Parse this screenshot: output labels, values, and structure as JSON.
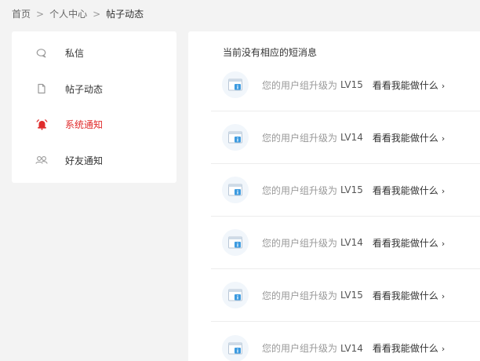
{
  "breadcrumb": {
    "home": "首页",
    "separator": ">",
    "personal_center": "个人中心",
    "current": "帖子动态"
  },
  "sidebar": {
    "items": [
      {
        "label": "私信",
        "icon": "chat-bubble-icon"
      },
      {
        "label": "帖子动态",
        "icon": "document-icon"
      },
      {
        "label": "系统通知",
        "icon": "alarm-bell-icon",
        "active": true
      },
      {
        "label": "好友通知",
        "icon": "friends-icon"
      }
    ]
  },
  "main": {
    "empty_message": "当前没有相应的短消息",
    "messages": [
      {
        "text": "您的用户组升级为",
        "level": "LV15",
        "link": "看看我能做什么",
        "arrow": "›"
      },
      {
        "text": "您的用户组升级为",
        "level": "LV14",
        "link": "看看我能做什么",
        "arrow": "›"
      },
      {
        "text": "您的用户组升级为",
        "level": "LV15",
        "link": "看看我能做什么",
        "arrow": "›"
      },
      {
        "text": "您的用户组升级为",
        "level": "LV14",
        "link": "看看我能做什么",
        "arrow": "›"
      },
      {
        "text": "您的用户组升级为",
        "level": "LV15",
        "link": "看看我能做什么",
        "arrow": "›"
      },
      {
        "text": "您的用户组升级为",
        "level": "LV14",
        "link": "看看我能做什么",
        "arrow": "›"
      }
    ]
  },
  "colors": {
    "accent_active": "#e02b2b",
    "icon_gray": "#9a9a9a",
    "system_icon_blue": "#3d9be0"
  }
}
